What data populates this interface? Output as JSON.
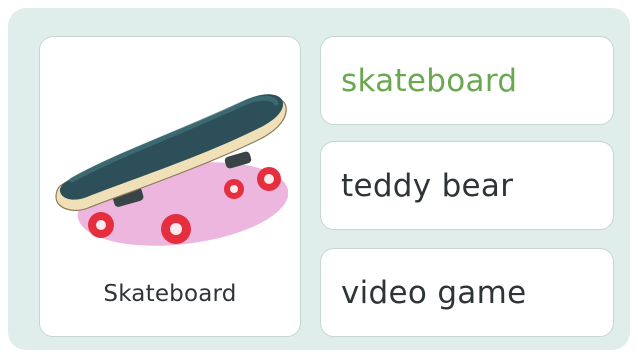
{
  "card": {
    "caption": "Skateboard",
    "image_icon": "skateboard-illustration"
  },
  "choices": [
    {
      "label": "skateboard",
      "selected": true
    },
    {
      "label": "teddy bear",
      "selected": false
    },
    {
      "label": "video game",
      "selected": false
    }
  ],
  "colors": {
    "panel_background": "#dfeeea",
    "card_background": "#ffffff",
    "card_border": "#c6d6d1",
    "text": "#2f3437",
    "selected_text": "#6aa84f",
    "board_deck": "#2d4f5a",
    "wheel": "#e52f3f",
    "shadow": "#edb6df"
  }
}
